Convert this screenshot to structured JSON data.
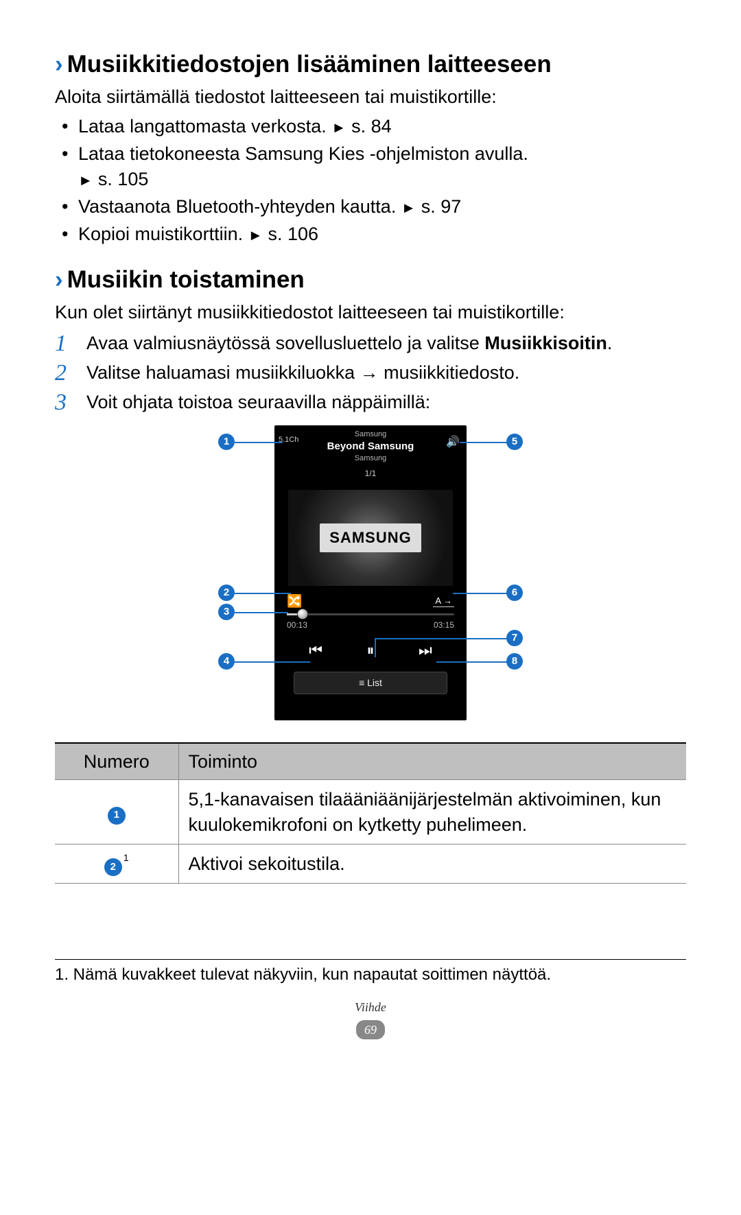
{
  "section1": {
    "heading": "Musiikkitiedostojen lisääminen laitteeseen",
    "intro": "Aloita siirtämällä tiedostot laitteeseen tai muistikortille:",
    "bullets": [
      {
        "text": "Lataa langattomasta verkosta.",
        "ref": "s. 84"
      },
      {
        "text": "Lataa tietokoneesta Samsung Kies -ohjelmiston avulla.",
        "ref": "s. 105"
      },
      {
        "text": "Vastaanota Bluetooth-yhteyden kautta.",
        "ref": "s. 97"
      },
      {
        "text": "Kopioi muistikorttiin.",
        "ref": "s. 106"
      }
    ]
  },
  "section2": {
    "heading": "Musiikin toistaminen",
    "intro": "Kun olet siirtänyt musiikkitiedostot laitteeseen tai muistikortille:",
    "steps": [
      {
        "num": "1",
        "text_a": "Avaa valmiusnäytössä sovellusluettelo ja valitse",
        "text_b": "Musiikkisoitin",
        "text_c": "."
      },
      {
        "num": "2",
        "text_a": "Valitse haluamasi musiikkiluokka → musiikkitiedosto."
      },
      {
        "num": "3",
        "text_a": "Voit ohjata toistoa seuraavilla näppäimillä:"
      }
    ]
  },
  "phone": {
    "top_small1": "Samsung",
    "title": "Beyond Samsung",
    "top_small2": "Samsung",
    "track_count": "1/1",
    "ch_label": "5.1Ch",
    "album_text": "SAMSUNG",
    "repeat_label": "A",
    "time_elapsed": "00:13",
    "time_total": "03:15",
    "list_label": "≡ List"
  },
  "callouts": {
    "n1": "1",
    "n2": "2",
    "n3": "3",
    "n4": "4",
    "n5": "5",
    "n6": "6",
    "n7": "7",
    "n8": "8"
  },
  "table": {
    "h1": "Numero",
    "h2": "Toiminto",
    "rows": [
      {
        "num": "1",
        "sup": "",
        "desc": "5,1-kanavaisen tilaääniäänijärjestelmän aktivoiminen, kun kuulokemikrofoni on kytketty puhelimeen."
      },
      {
        "num": "2",
        "sup": "1",
        "desc": "Aktivoi sekoitustila."
      }
    ]
  },
  "footnote": "1. Nämä kuvakkeet tulevat näkyviin, kun napautat soittimen näyttöä.",
  "footer": {
    "section": "Viihde",
    "page": "69"
  }
}
